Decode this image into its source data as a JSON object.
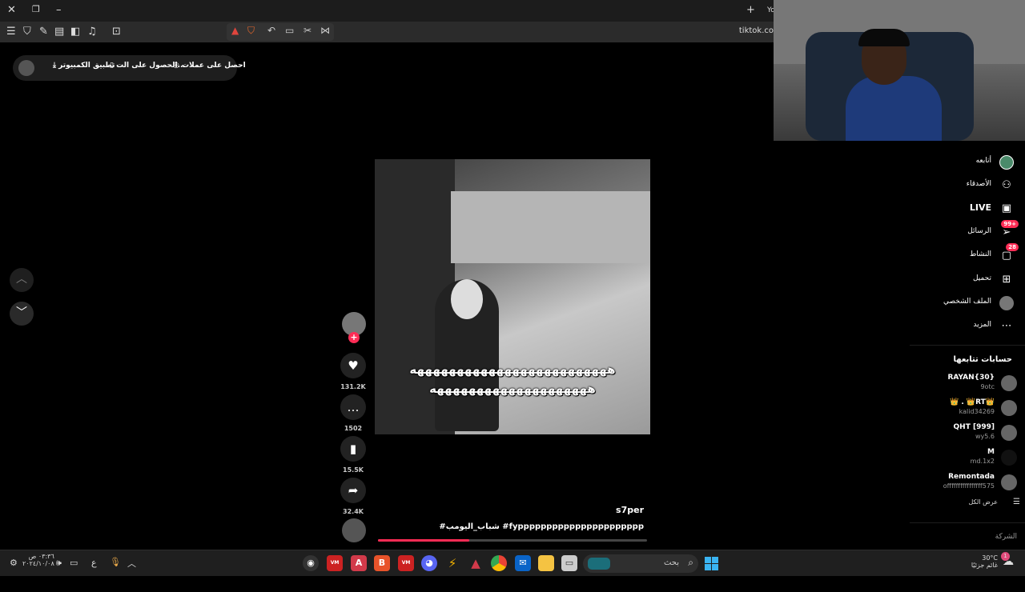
{
  "browser": {
    "tab_truncated": "Yo",
    "url": "tiktok.co"
  },
  "topbar": {
    "coins": "احصل على عملات",
    "get_app": "الحصول على الت...",
    "desktop_app": "تطبيق الكمبيوتر"
  },
  "video": {
    "caption_line1": "هههههههههههههههههههههههههه",
    "caption_line2": "ههههههههههههههههههههه",
    "author": "s7per",
    "description": "#شباب_اليومب #fypppppppppppppppppppppp",
    "progress_fraction": 0.34
  },
  "actions": {
    "likes": "131.2K",
    "comments": "1502",
    "saves": "15.5K",
    "shares": "32.4K"
  },
  "sidebar": {
    "nav": [
      {
        "label": "أتابعه",
        "icon": "avatar-icon"
      },
      {
        "label": "الأصدقاء",
        "icon": "friends-icon"
      },
      {
        "label": "LIVE",
        "icon": "live-icon"
      },
      {
        "label": "الرسائل",
        "icon": "messages-icon",
        "badge": "99+"
      },
      {
        "label": "النشاط",
        "icon": "activity-icon",
        "badge": "28"
      },
      {
        "label": "تحميل",
        "icon": "upload-icon"
      },
      {
        "label": "الملف الشخصي",
        "icon": "profile-icon"
      },
      {
        "label": "المزيد",
        "icon": "more-icon"
      }
    ],
    "following_header": "حسابات تتابعها",
    "following": [
      {
        "name": "RAYAN{30}",
        "user": "9otc"
      },
      {
        "name": "👑 . 👑RT👑",
        "user": "kalid34269"
      },
      {
        "name": "QHT [999]",
        "user": "wy5.6"
      },
      {
        "name": "M",
        "user": "md.1x2"
      },
      {
        "name": "Remontada",
        "user": "offffffffffffffff575"
      }
    ],
    "view_all": "عرض الكل",
    "company": "الشركة"
  },
  "taskbar": {
    "search_label": "بحث",
    "time": "٠٣:٣٦ ص",
    "date": "٢٠٢٤/١٠/٠٨",
    "lang": "ع",
    "weather_temp": "30°C",
    "weather_desc": "غائم جزئيًا",
    "notif_count": "1"
  },
  "colors": {
    "accent": "#fe2c55",
    "background": "#000000"
  }
}
